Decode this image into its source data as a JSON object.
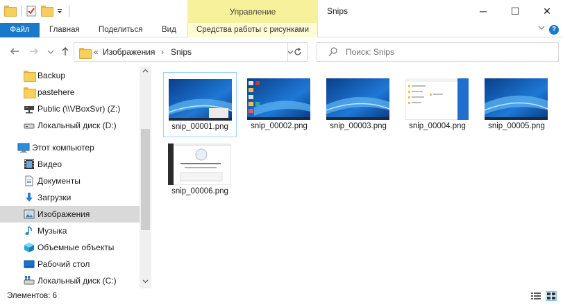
{
  "window": {
    "title": "Snips",
    "manage_tab": "Управление",
    "controls": {
      "minimize": "─",
      "maximize": "☐",
      "close": "✕"
    }
  },
  "ribbon": {
    "tabs": [
      "Файл",
      "Главная",
      "Поделиться",
      "Вид",
      "Средства работы с рисунками"
    ],
    "accent": "#1979ca",
    "tools_bg": "#fffbd5",
    "manage_bg": "#f8f19c"
  },
  "address": {
    "overflow": "«",
    "crumbs": [
      "Изображения",
      "Snips"
    ],
    "separator": "›"
  },
  "search": {
    "placeholder": "Поиск: Snips"
  },
  "sidebar": {
    "items": [
      {
        "label": "Backup",
        "icon": "folder-icon"
      },
      {
        "label": "pastehere",
        "icon": "folder-icon"
      },
      {
        "label": "Public (\\\\VBoxSvr) (Z:)",
        "icon": "network-drive-icon"
      },
      {
        "label": "Локальный диск (D:)",
        "icon": "drive-icon"
      },
      {
        "label": "Этот компьютер",
        "icon": "computer-icon"
      },
      {
        "label": "Видео",
        "icon": "video-icon"
      },
      {
        "label": "Документы",
        "icon": "documents-icon"
      },
      {
        "label": "Загрузки",
        "icon": "downloads-icon"
      },
      {
        "label": "Изображения",
        "icon": "pictures-icon",
        "selected": true
      },
      {
        "label": "Музыка",
        "icon": "music-icon"
      },
      {
        "label": "Объемные объекты",
        "icon": "3d-objects-icon"
      },
      {
        "label": "Рабочий стол",
        "icon": "desktop-icon"
      },
      {
        "label": "Локальный диск (C:)",
        "icon": "system-drive-icon"
      }
    ]
  },
  "files": [
    {
      "name": "snip_00001.png",
      "selected": true
    },
    {
      "name": "snip_00002.png"
    },
    {
      "name": "snip_00003.png"
    },
    {
      "name": "snip_00004.png"
    },
    {
      "name": "snip_00005.png"
    },
    {
      "name": "snip_00006.png"
    }
  ],
  "status": {
    "items_count": "Элементов: 6"
  }
}
